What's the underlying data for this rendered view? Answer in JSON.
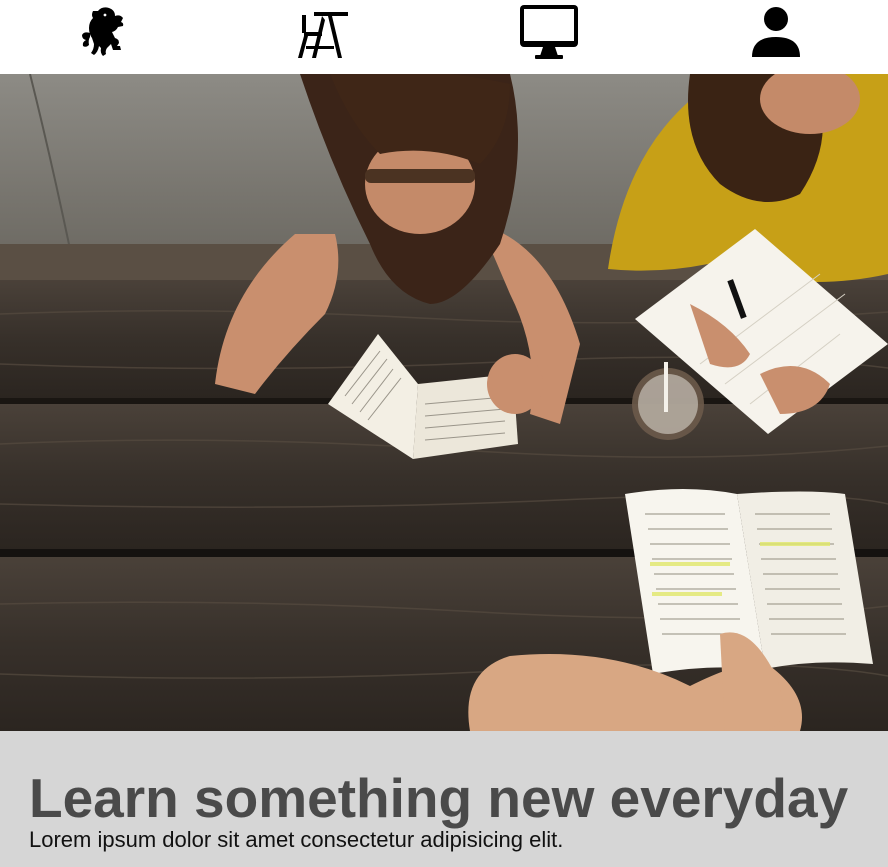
{
  "nav": {
    "items": [
      {
        "icon": "lion-rampant-icon"
      },
      {
        "icon": "school-desk-icon"
      },
      {
        "icon": "monitor-icon"
      },
      {
        "icon": "user-icon"
      }
    ]
  },
  "hero": {
    "image": "students-studying-at-picnic-table-photo"
  },
  "banner": {
    "heading": "Learn something new everyday",
    "subtext": "Lorem ipsum dolor sit amet consectetur adipisicing elit."
  },
  "colors": {
    "nav_background": "#ffffff",
    "icon_color": "#000000",
    "banner_background": "#d6d6d6",
    "heading_color": "#4a4a4a",
    "subtext_color": "#111111"
  }
}
